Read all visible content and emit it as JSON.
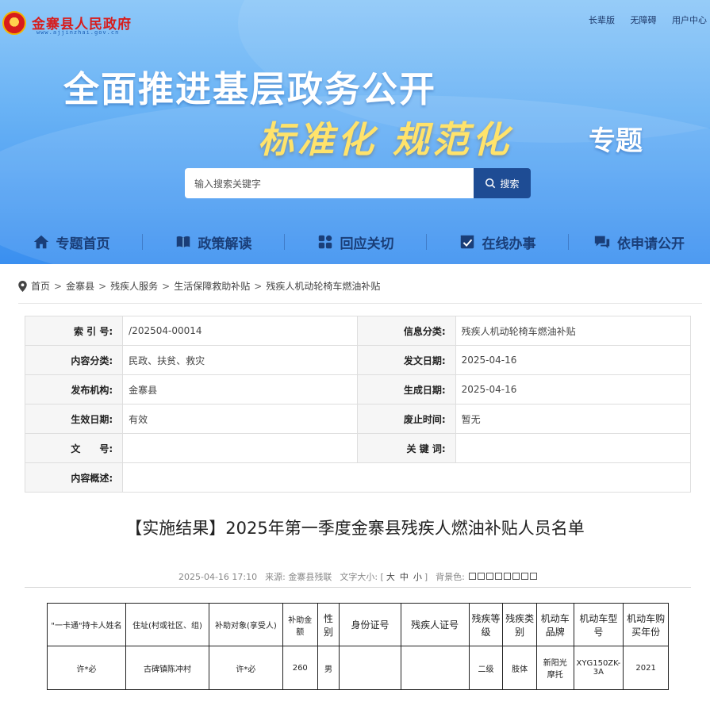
{
  "site": {
    "name": "金寨县人民政府",
    "domain": "www.ajjinzhai.gov.cn",
    "top_links": [
      "长辈版",
      "无障碍",
      "用户中心"
    ]
  },
  "banner": {
    "headline": "全面推进基层政务公开",
    "subhead": "标准化  规范化",
    "subhead_tail": "专题"
  },
  "search": {
    "placeholder": "输入搜索关键字",
    "button_label": "搜索"
  },
  "nav": [
    {
      "label": "专题首页",
      "icon": "home-icon"
    },
    {
      "label": "政策解读",
      "icon": "book-icon"
    },
    {
      "label": "回应关切",
      "icon": "grid-icon"
    },
    {
      "label": "在线办事",
      "icon": "checkbox-icon"
    },
    {
      "label": "依申请公开",
      "icon": "chat-icon"
    }
  ],
  "breadcrumb": [
    "首页",
    "金寨县",
    "残疾人服务",
    "生活保障救助补贴",
    "残疾人机动轮椅车燃油补贴"
  ],
  "info": {
    "index_label": "索 引 号:",
    "index_value": "/202504-00014",
    "category_label": "信息分类:",
    "category_value": "残疾人机动轮椅车燃油补贴",
    "content_cat_label": "内容分类:",
    "content_cat_value": "民政、扶贫、救灾",
    "issue_date_label": "发文日期:",
    "issue_date_value": "2025-04-16",
    "org_label": "发布机构:",
    "org_value": "金寨县",
    "gen_date_label": "生成日期:",
    "gen_date_value": "2025-04-16",
    "effective_label": "生效日期:",
    "effective_value": "有效",
    "expire_label": "废止时间:",
    "expire_value": "暂无",
    "docno_label": "文　　号:",
    "docno_value": "",
    "keywords_label": "关 键 词:",
    "keywords_value": "",
    "summary_label": "内容概述:",
    "summary_value": ""
  },
  "article": {
    "title": "【实施结果】2025年第一季度金寨县残疾人燃油补贴人员名单",
    "datetime": "2025-04-16 17:10",
    "source": "来源:  金寨县残联",
    "font_size_label": "文字大小:",
    "font_sizes": [
      "大",
      "中",
      "小"
    ],
    "bg_label": "背景色:"
  },
  "list_table": {
    "headers": [
      "\"一卡通\"持卡人姓名",
      "住址(村或社区、组)",
      "补助对象(享受人)",
      "补助金额",
      "性别",
      "身份证号",
      "残疾人证号",
      "残疾等级",
      "残疾类别",
      "机动车品牌",
      "机动车型号",
      "机动车购买年份"
    ],
    "rows": [
      [
        "许*必",
        "古碑镇陈冲村",
        "许*必",
        "260",
        "男",
        "",
        "",
        "二级",
        "肢体",
        "新阳光摩托",
        "XYG150ZK-3A",
        "2021"
      ]
    ]
  },
  "colors": {
    "brand_red": "#d71c1c",
    "nav_text": "#1a3e78",
    "search_button": "#1e4c94",
    "banner_blue": "#3a8ff0"
  }
}
